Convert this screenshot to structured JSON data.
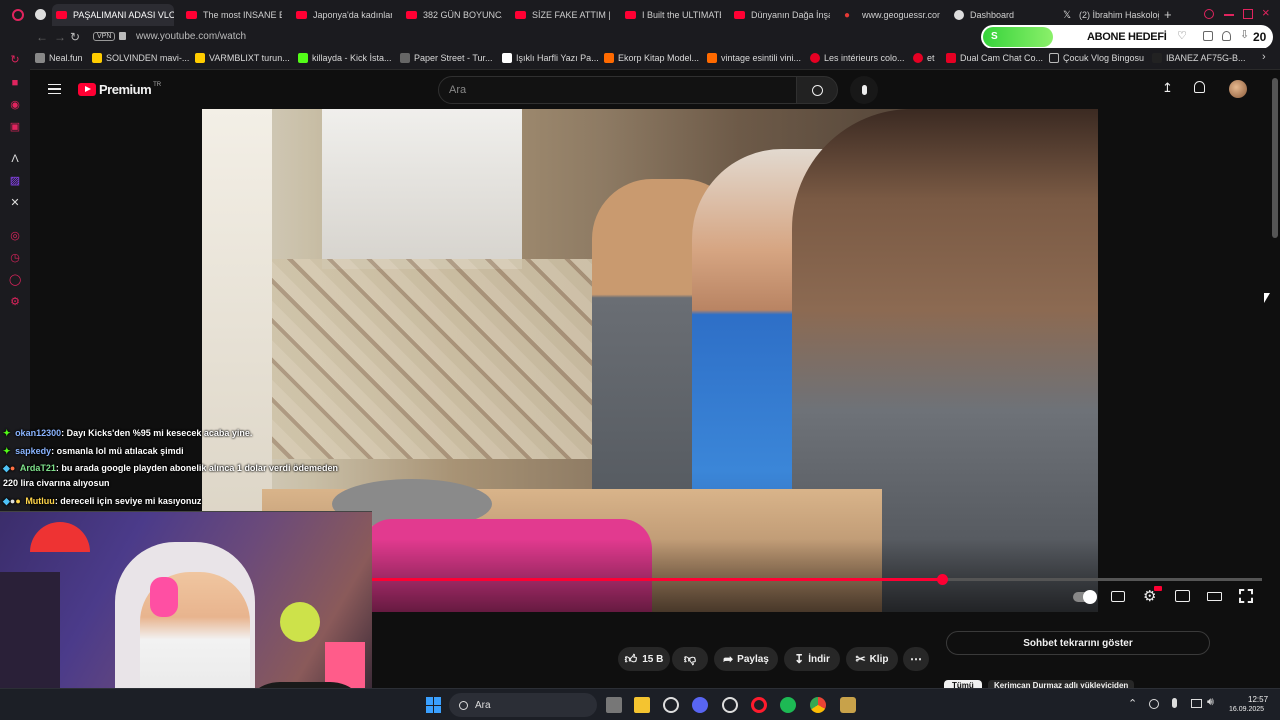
{
  "tabs": [
    {
      "label": "PAŞALIMANI ADASI VLOG",
      "active": true
    },
    {
      "label": "The most INSANE B"
    },
    {
      "label": "Japonya'da kadınlar"
    },
    {
      "label": "382 GÜN BOYUNCA"
    },
    {
      "label": "SİZE FAKE ATTIM | S"
    },
    {
      "label": "I Built the ULTIMATE"
    },
    {
      "label": "Dünyanın Dağa İnşa"
    },
    {
      "label": "www.geoguessr.com"
    },
    {
      "label": "Dashboard"
    },
    {
      "label": "(2) İbrahim Haskoloğ"
    }
  ],
  "address": {
    "vpn": "VPN",
    "url": "www.youtube.com/watch"
  },
  "bookmarks": [
    "Neal.fun",
    "SOLVINDEN mavi-...",
    "VARMBLIXT turun...",
    "killayda - Kick İsta...",
    "Paper Street - Tur...",
    "Işıklı Harfli Yazı Pa...",
    "Ekorp Kitap Model...",
    "vintage esintili vini...",
    "Les intérieurs colo...",
    "et",
    "Dual Cam Chat Co...",
    "Çocuk Vlog Bingosu",
    "IBANEZ AF75G-B..."
  ],
  "overlay_goal": {
    "label": "ABONE HEDEFİ",
    "count": "20",
    "letter": "S"
  },
  "youtube": {
    "brand": "Premium",
    "region": "TR",
    "search_placeholder": "Ara"
  },
  "chat": [
    {
      "user": "okan12300",
      "msg": ": Dayı Kicks'den %95 mi kesecek acaba yine.",
      "color": "#8ab4ff"
    },
    {
      "user": "sapkedy",
      "msg": ": osmanla lol mü atılacak şimdi",
      "color": "#8ab4ff"
    },
    {
      "user": "ArdaT21",
      "msg": ": bu arada google playden abonelik alınca 1 dolar verdi ödemeden",
      "msg2": "220 lira civarına alıyosun",
      "color": "#7ee08a"
    },
    {
      "user": "Mutluu",
      "msg": ": dereceli için seviye mi kasıyonuz",
      "color": "#ffd54a"
    }
  ],
  "player": {
    "progress": 0.64
  },
  "actions": {
    "likes": "15 B",
    "share": "Paylaş",
    "download": "İndir",
    "clip": "Klip",
    "chat_replay": "Sohbet tekrarını göster"
  },
  "below": {
    "chip1": "Tümü",
    "chip2": "Kerimcan Durmaz adlı yükleyiciden"
  },
  "taskbar": {
    "search": "Ara",
    "time": "12:57",
    "date": "16.09.2025"
  }
}
